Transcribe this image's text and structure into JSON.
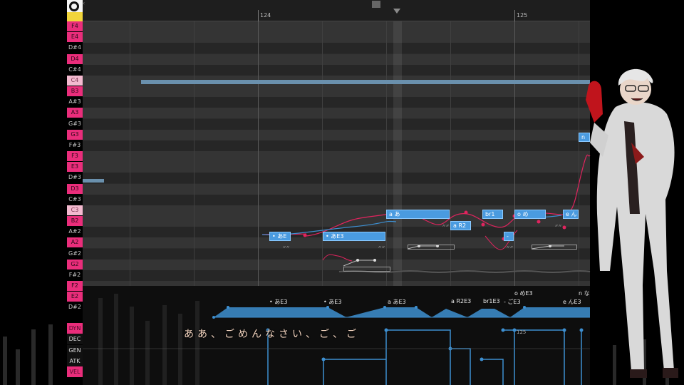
{
  "ruler": {
    "bar_124": "124",
    "bar_125": "125",
    "scroll_left_arrow": "‹"
  },
  "keys": [
    {
      "label": "F4",
      "style": "pink"
    },
    {
      "label": "E4",
      "style": "pink"
    },
    {
      "label": "D#4",
      "style": "black"
    },
    {
      "label": "D4",
      "style": "pink"
    },
    {
      "label": "C#4",
      "style": "black"
    },
    {
      "label": "C4",
      "style": "white-c"
    },
    {
      "label": "B3",
      "style": "pink"
    },
    {
      "label": "A#3",
      "style": "black"
    },
    {
      "label": "A3",
      "style": "pink"
    },
    {
      "label": "G#3",
      "style": "black"
    },
    {
      "label": "G3",
      "style": "pink"
    },
    {
      "label": "F#3",
      "style": "black"
    },
    {
      "label": "F3",
      "style": "pink"
    },
    {
      "label": "E3",
      "style": "pink"
    },
    {
      "label": "D#3",
      "style": "black"
    },
    {
      "label": "D3",
      "style": "pink"
    },
    {
      "label": "C#3",
      "style": "black"
    },
    {
      "label": "C3",
      "style": "white-c"
    },
    {
      "label": "B2",
      "style": "pink"
    },
    {
      "label": "A#2",
      "style": "black"
    },
    {
      "label": "A2",
      "style": "pink"
    },
    {
      "label": "G#2",
      "style": "black"
    },
    {
      "label": "G2",
      "style": "pink"
    },
    {
      "label": "F#2",
      "style": "black"
    },
    {
      "label": "F2",
      "style": "pink"
    },
    {
      "label": "E2",
      "style": "pink"
    },
    {
      "label": "D#2",
      "style": "black"
    }
  ],
  "notes": [
    {
      "id": "n1",
      "lyric": "• あE",
      "pitch": "A#2"
    },
    {
      "id": "n2",
      "lyric": "• あE3",
      "pitch": "A#2"
    },
    {
      "id": "n3",
      "lyric": "a あ",
      "pitch": "C3"
    },
    {
      "id": "n4",
      "lyric": "a R2",
      "pitch": "B2"
    },
    {
      "id": "n5",
      "lyric": "br1",
      "pitch": "C3"
    },
    {
      "id": "n6",
      "lyric": "- ",
      "pitch": "A#2"
    },
    {
      "id": "n7",
      "lyric": "o め",
      "pitch": "C3"
    },
    {
      "id": "n8",
      "lyric": "e ん",
      "pitch": "C3"
    },
    {
      "id": "n9",
      "lyric": "n",
      "pitch": "G3"
    }
  ],
  "phonemes": [
    "• あE3",
    "• あE3",
    "a あE3",
    "a R2E3",
    "br1E3",
    "- ごE3",
    "o めE3",
    "e んE3",
    "n な"
  ],
  "lanes": [
    {
      "label": "DYN",
      "active": true
    },
    {
      "label": "DEC",
      "active": false
    },
    {
      "label": "GEN",
      "active": false
    },
    {
      "label": "ATK",
      "active": false
    },
    {
      "label": "VEL",
      "active": true
    }
  ],
  "lane_marker": "125",
  "subtitle": "ああ、ごめんなさい、ご、ご",
  "colors": {
    "note": "#4a9be0",
    "key_accent": "#ea2d7b",
    "pitch_curve": "#e0245e",
    "envelope": "#3d8fd0"
  }
}
